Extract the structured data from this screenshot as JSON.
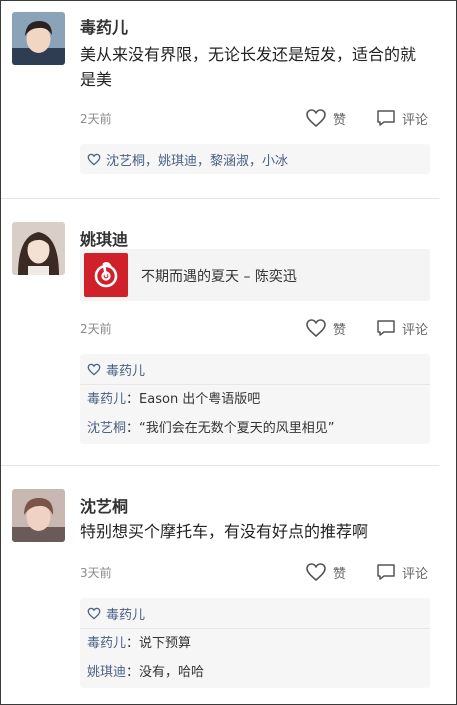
{
  "posts": [
    {
      "name": "毒药儿",
      "text": "美从来没有界限，无论长发还是短发，适合的就是美",
      "time": "2天前",
      "like_label": "赞",
      "comment_label": "评论",
      "likes": "沈艺桐，姚琪迪，黎涵淑，小冰"
    },
    {
      "name": "姚琪迪",
      "music": "不期而遇的夏天 – 陈奕迅",
      "time": "2天前",
      "like_label": "赞",
      "comment_label": "评论",
      "likes": "毒药儿",
      "comments": [
        {
          "who": "毒药儿",
          "text": "Eason 出个粤语版吧"
        },
        {
          "who": "沈艺桐",
          "text": "“我们会在无数个夏天的风里相见”"
        }
      ]
    },
    {
      "name": "沈艺桐",
      "text": "特别想买个摩托车，有没有好点的推荐啊",
      "time": "3天前",
      "like_label": "赞",
      "comment_label": "评论",
      "likes": "毒药儿",
      "comments": [
        {
          "who": "毒药儿",
          "text": "说下预算"
        },
        {
          "who": "姚琪迪",
          "text": "没有，哈哈"
        }
      ]
    }
  ],
  "colors": {
    "link": "#4a6183",
    "music_cover": "#d0202a",
    "panel_bg": "#f6f6f7"
  },
  "icons": [
    "heart-icon",
    "comment-icon",
    "netease-music-icon"
  ]
}
